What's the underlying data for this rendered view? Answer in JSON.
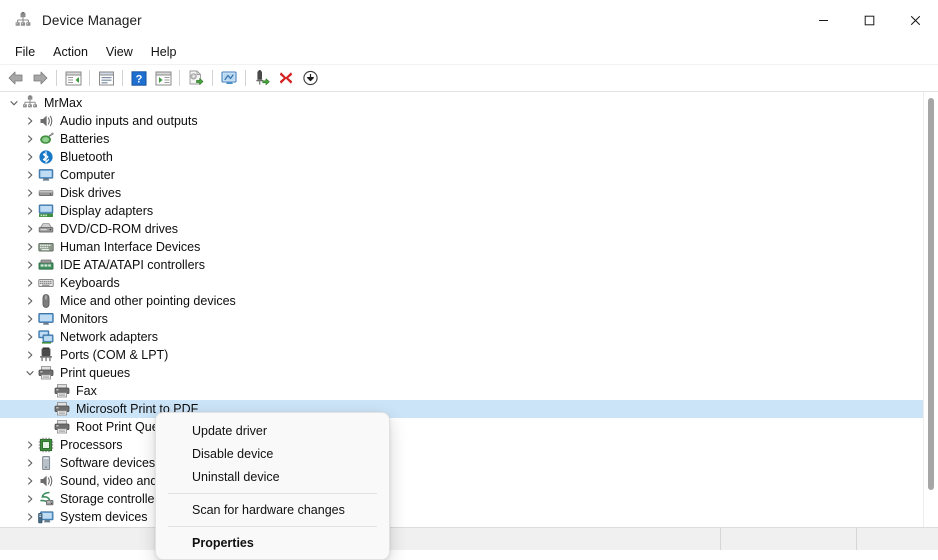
{
  "window": {
    "title": "Device Manager",
    "icon": "device-manager-icon",
    "controls": {
      "minimize": "minimize-icon",
      "maximize": "maximize-icon",
      "close": "close-icon"
    }
  },
  "menubar": {
    "items": [
      {
        "label": "File"
      },
      {
        "label": "Action"
      },
      {
        "label": "View"
      },
      {
        "label": "Help"
      }
    ]
  },
  "toolbar": {
    "buttons": [
      {
        "name": "back-icon",
        "type": "arrow-left"
      },
      {
        "name": "forward-icon",
        "type": "arrow-right"
      },
      {
        "name": "separator-1",
        "type": "separator"
      },
      {
        "name": "show-hide-console-tree-icon",
        "type": "console-tree"
      },
      {
        "name": "separator-2",
        "type": "separator"
      },
      {
        "name": "properties-icon",
        "type": "properties"
      },
      {
        "name": "separator-3",
        "type": "separator"
      },
      {
        "name": "help-icon",
        "type": "help"
      },
      {
        "name": "show-action-pane-icon",
        "type": "action-pane"
      },
      {
        "name": "separator-4",
        "type": "separator"
      },
      {
        "name": "update-driver-icon",
        "type": "update-driver"
      },
      {
        "name": "separator-5",
        "type": "separator"
      },
      {
        "name": "scan-for-hardware-changes-icon",
        "type": "scan-hardware"
      },
      {
        "name": "separator-6",
        "type": "separator"
      },
      {
        "name": "enable-device-icon",
        "type": "enable-device"
      },
      {
        "name": "uninstall-device-icon",
        "type": "uninstall-device"
      },
      {
        "name": "disable-device-icon",
        "type": "disable-device"
      }
    ]
  },
  "tree": {
    "nodes": [
      {
        "label": "MrMax",
        "depth": 0,
        "expanded": true,
        "icon": "computer-root-icon",
        "selected": false
      },
      {
        "label": "Audio inputs and outputs",
        "depth": 1,
        "expanded": false,
        "icon": "audio-icon",
        "selected": false
      },
      {
        "label": "Batteries",
        "depth": 1,
        "expanded": false,
        "icon": "battery-icon",
        "selected": false
      },
      {
        "label": "Bluetooth",
        "depth": 1,
        "expanded": false,
        "icon": "bluetooth-icon",
        "selected": false
      },
      {
        "label": "Computer",
        "depth": 1,
        "expanded": false,
        "icon": "computer-icon",
        "selected": false
      },
      {
        "label": "Disk drives",
        "depth": 1,
        "expanded": false,
        "icon": "disk-drive-icon",
        "selected": false
      },
      {
        "label": "Display adapters",
        "depth": 1,
        "expanded": false,
        "icon": "display-adapter-icon",
        "selected": false
      },
      {
        "label": "DVD/CD-ROM drives",
        "depth": 1,
        "expanded": false,
        "icon": "dvd-drive-icon",
        "selected": false
      },
      {
        "label": "Human Interface Devices",
        "depth": 1,
        "expanded": false,
        "icon": "hid-icon",
        "selected": false
      },
      {
        "label": "IDE ATA/ATAPI controllers",
        "depth": 1,
        "expanded": false,
        "icon": "ide-controller-icon",
        "selected": false
      },
      {
        "label": "Keyboards",
        "depth": 1,
        "expanded": false,
        "icon": "keyboard-icon",
        "selected": false
      },
      {
        "label": "Mice and other pointing devices",
        "depth": 1,
        "expanded": false,
        "icon": "mouse-icon",
        "selected": false
      },
      {
        "label": "Monitors",
        "depth": 1,
        "expanded": false,
        "icon": "monitor-icon",
        "selected": false
      },
      {
        "label": "Network adapters",
        "depth": 1,
        "expanded": false,
        "icon": "network-adapter-icon",
        "selected": false
      },
      {
        "label": "Ports (COM & LPT)",
        "depth": 1,
        "expanded": false,
        "icon": "port-icon",
        "selected": false
      },
      {
        "label": "Print queues",
        "depth": 1,
        "expanded": true,
        "icon": "printer-icon",
        "selected": false
      },
      {
        "label": "Fax",
        "depth": 2,
        "expanded": false,
        "icon": "printer-icon",
        "selected": false
      },
      {
        "label": "Microsoft Print to PDF",
        "depth": 2,
        "expanded": false,
        "icon": "printer-icon",
        "selected": true
      },
      {
        "label": "Root Print Queue",
        "depth": 2,
        "expanded": false,
        "icon": "printer-icon",
        "selected": false
      },
      {
        "label": "Processors",
        "depth": 1,
        "expanded": false,
        "icon": "processor-icon",
        "selected": false
      },
      {
        "label": "Software devices",
        "depth": 1,
        "expanded": false,
        "icon": "software-device-icon",
        "selected": false
      },
      {
        "label": "Sound, video and game controllers",
        "depth": 1,
        "expanded": false,
        "icon": "audio-icon",
        "selected": false
      },
      {
        "label": "Storage controllers",
        "depth": 1,
        "expanded": false,
        "icon": "storage-controller-icon",
        "selected": false
      },
      {
        "label": "System devices",
        "depth": 1,
        "expanded": false,
        "icon": "system-device-icon",
        "selected": false
      }
    ]
  },
  "context_menu": {
    "items": [
      {
        "label": "Update driver",
        "type": "item",
        "bold": false
      },
      {
        "label": "Disable device",
        "type": "item",
        "bold": false
      },
      {
        "label": "Uninstall device",
        "type": "item",
        "bold": false
      },
      {
        "label": "",
        "type": "separator",
        "bold": false
      },
      {
        "label": "Scan for hardware changes",
        "type": "item",
        "bold": false
      },
      {
        "label": "",
        "type": "separator",
        "bold": false
      },
      {
        "label": "Properties",
        "type": "item",
        "bold": true
      }
    ]
  },
  "statusbar": {
    "cells": [
      "",
      "",
      ""
    ]
  },
  "colors": {
    "selection": "#cce4f7",
    "accent": "#0078d4",
    "status_bg": "#f0f0f0"
  }
}
